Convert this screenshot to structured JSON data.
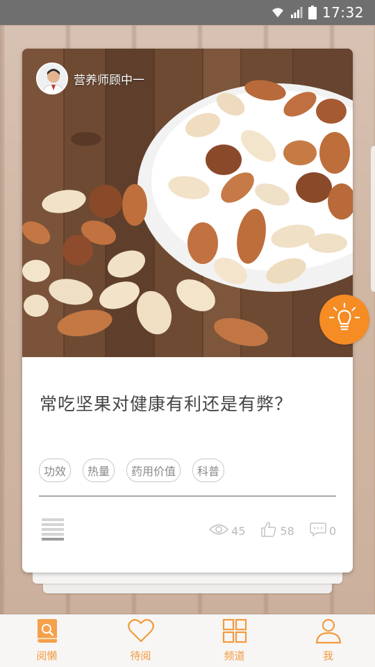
{
  "status_bar": {
    "time": "17:32",
    "icons": [
      "wifi-icon",
      "signal-icon",
      "battery-icon"
    ]
  },
  "card": {
    "author_name": "营养师顾中一",
    "author_avatar": "avatar-icon",
    "image": "mixed-nuts-bowl-photo",
    "title": "常吃坚果对健康有利还是有弊？",
    "tags": [
      "功效",
      "热量",
      "药用价值",
      "科普"
    ],
    "stats": {
      "views": "45",
      "likes": "58",
      "comments": "0"
    }
  },
  "bottom_nav": {
    "items": [
      {
        "label": "阅懒",
        "icon": "book-search-icon",
        "active": true
      },
      {
        "label": "待阅",
        "icon": "heart-icon",
        "active": false
      },
      {
        "label": "频道",
        "icon": "grid-icon",
        "active": false
      },
      {
        "label": "我",
        "icon": "person-icon",
        "active": false
      }
    ]
  },
  "colors": {
    "accent": "#f58c24",
    "nav_text": "#f39a3d",
    "status_bar": "#6f6f6f",
    "card_bg": "#ffffff",
    "title_text": "#444444",
    "tag_text": "#888888",
    "stat_text": "#b9b9b9"
  }
}
